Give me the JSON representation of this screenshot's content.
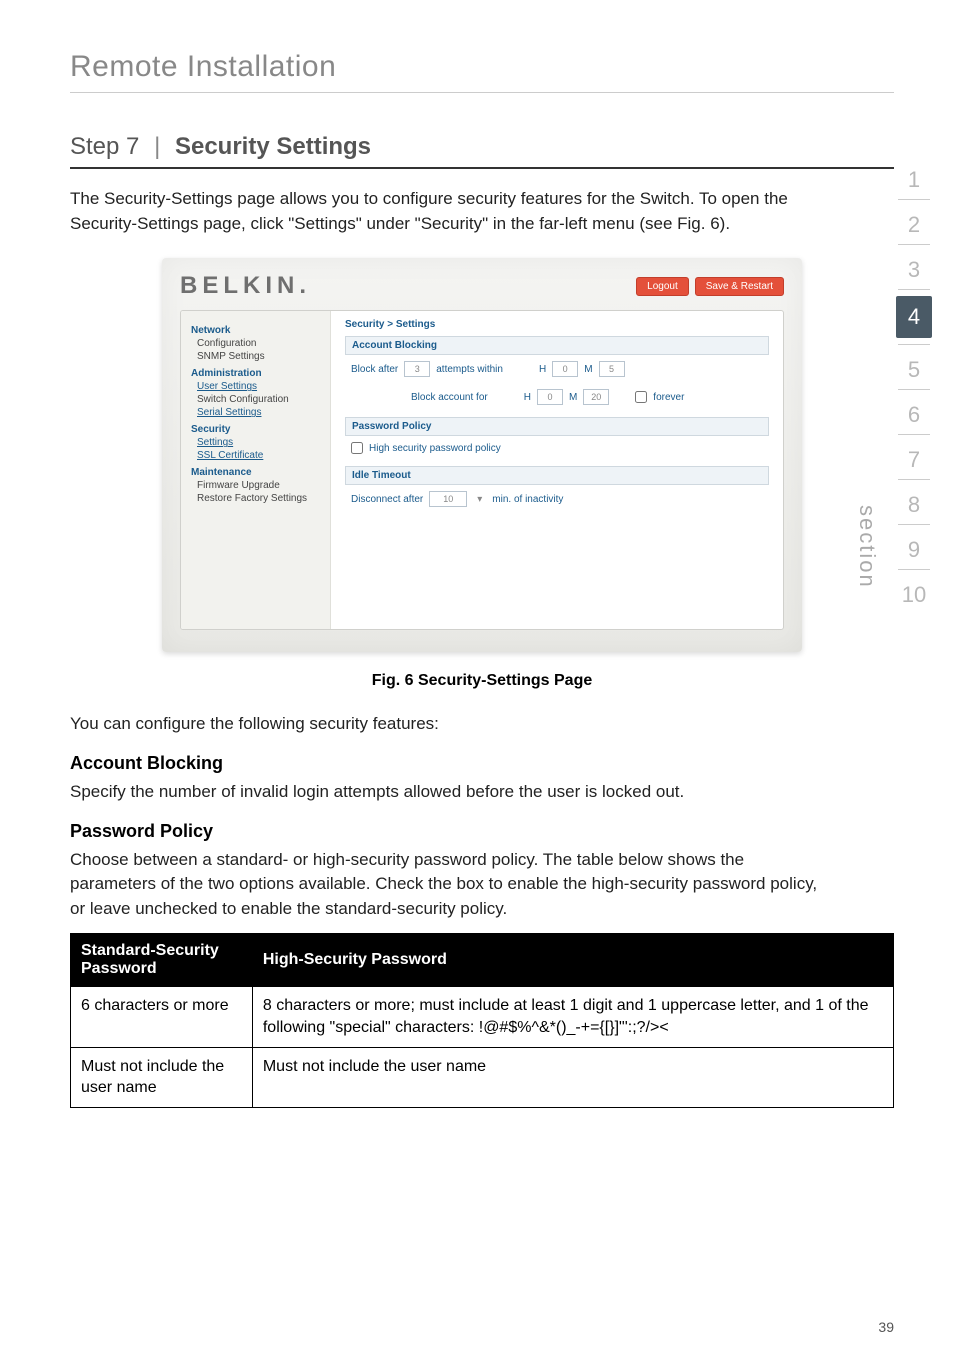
{
  "page_header": "Remote Installation",
  "step_title_prefix": "Step 7",
  "step_title_main": "Security Settings",
  "intro": "The Security-Settings page allows you to configure security features for the Switch. To open the Security-Settings page, click \"Settings\" under \"Security\" in the far-left menu (see Fig. 6).",
  "screenshot": {
    "logo": "BELKIN.",
    "btn_logout": "Logout",
    "btn_save": "Save & Restart",
    "nav": {
      "network": "Network",
      "configuration": "Configuration",
      "snmp": "SNMP Settings",
      "administration": "Administration",
      "user_settings": "User Settings",
      "switch_config": "Switch Configuration",
      "serial": "Serial Settings",
      "security": "Security",
      "settings": "Settings",
      "ssl": "SSL Certificate",
      "maintenance": "Maintenance",
      "firmware": "Firmware Upgrade",
      "restore": "Restore Factory Settings"
    },
    "crumb": "Security > Settings",
    "sect_account": "Account Blocking",
    "lbl_block_after": "Block after",
    "val_attempts": "3",
    "lbl_attempts_within": "attempts within",
    "lbl_h": "H",
    "val_h1": "0",
    "lbl_m": "M",
    "val_m1": "5",
    "lbl_block_account_for": "Block account for",
    "val_h2": "0",
    "val_m2": "20",
    "lbl_forever": "forever",
    "sect_password": "Password Policy",
    "lbl_high_sec": "High security password policy",
    "sect_idle": "Idle Timeout",
    "lbl_disconnect": "Disconnect after",
    "val_idle": "10",
    "lbl_min_inact": "min. of inactivity"
  },
  "caption": "Fig. 6 Security-Settings Page",
  "body1": "You can configure the following security features:",
  "sub_account": "Account Blocking",
  "body_account": "Specify the number of invalid login attempts allowed before the user is locked out.",
  "sub_password": "Password Policy",
  "body_password": "Choose between a standard- or high-security password policy. The table below shows the parameters of the two options available. Check the box to enable the high-security password policy, or leave unchecked to enable the standard-security policy.",
  "table": {
    "h1": "Standard-Security Password",
    "h2": "High-Security Password",
    "r1c1": "6 characters or more",
    "r1c2": "8 characters or more; must include at least 1 digit and 1 uppercase letter, and 1 of the following \"special\" characters: !@#$%^&*()_-+={[}]\"':;?/><",
    "r2c1": "Must not include the user name",
    "r2c2": "Must not include the user name"
  },
  "rail": {
    "n1": "1",
    "n2": "2",
    "n3": "3",
    "n4": "4",
    "n5": "5",
    "n6": "6",
    "n7": "7",
    "n8": "8",
    "n9": "9",
    "n10": "10",
    "label": "section"
  },
  "page_number": "39"
}
